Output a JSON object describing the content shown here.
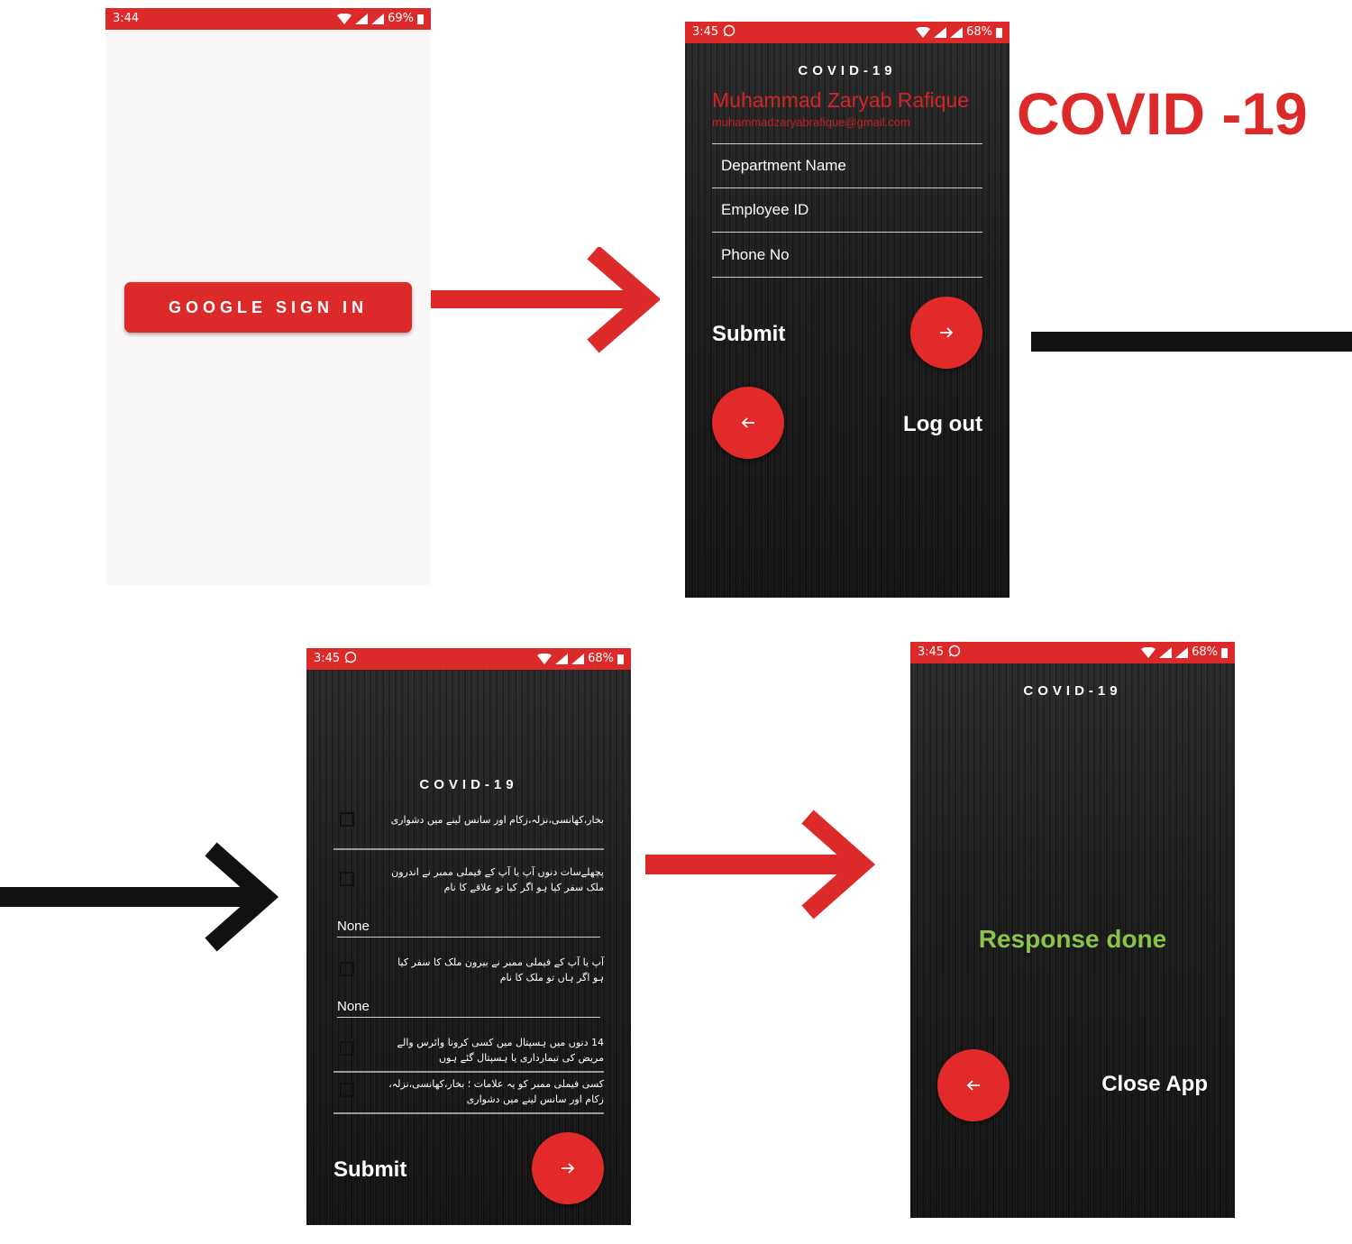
{
  "colors": {
    "brand_red": "#dc2a2a",
    "success_green": "#8bc34a",
    "arrow_black": "#111111"
  },
  "heading": {
    "title": "COVID -19"
  },
  "screen1": {
    "status": {
      "time": "3:44",
      "battery": "69%"
    },
    "google_button_label": "GOOGLE SIGN IN"
  },
  "screen2": {
    "status": {
      "time": "3:45",
      "battery": "68%"
    },
    "app_title": "COVID-19",
    "user_name": "Muhammad Zaryab Rafique",
    "user_email": "muhammadzaryabrafique@gmail.com",
    "fields": {
      "department_placeholder": "Department Name",
      "employee_placeholder": "Employee ID",
      "phone_placeholder": "Phone No"
    },
    "submit_label": "Submit",
    "logout_label": "Log out",
    "icons": {
      "submit": "arrow-right-icon",
      "back": "arrow-left-icon"
    }
  },
  "screen3": {
    "status": {
      "time": "3:45",
      "battery": "68%"
    },
    "app_title": "COVID-19",
    "questions": [
      "بخار،کھانسی،نزلہ،زکام اور سانس لینے میں دشواری",
      "پچھلےسات دنوں آپ یا آپ کے فیملی ممبر نے اندرون ملک سفر کیا ہو اگر کیا تو علاقے کا نام",
      "آپ یا آپ کے فیملی ممبر نے بیرون ملک کا سفر کیا ہو اگر ہاں تو ملک کا نام",
      "14 دنوں میں ہسپتال میں کسی کرونا وائرس والے مریض کی تیمارداری یا ہسپتال گئے ہوں",
      "کسی فیملی ممبر کو یہ علامات ؛ بخار،کھانسی،نزلہ، زکام اور سانس لینے میں دشواری"
    ],
    "domestic_travel_value": "None",
    "foreign_travel_value": "None",
    "submit_label": "Submit"
  },
  "screen4": {
    "status": {
      "time": "3:45",
      "battery": "68%"
    },
    "app_title": "COVID-19",
    "response_text": "Response done",
    "close_label": "Close App"
  }
}
